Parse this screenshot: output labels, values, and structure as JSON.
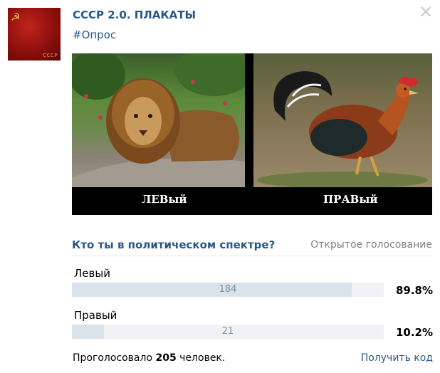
{
  "group": {
    "name": "СССР 2.0. ПЛАКАТЫ",
    "hashtag": "#Опрос",
    "avatar_icon": "hammer-sickle-icon",
    "avatar_tag": "СССР"
  },
  "poster": {
    "left_caption": "ЛЕВый",
    "right_caption": "ПРАВый",
    "left_subject": "lion",
    "right_subject": "rooster"
  },
  "poll": {
    "question": "Кто ты в политическом спектре?",
    "type_label": "Открытое голосование",
    "options": [
      {
        "label": "Левый",
        "votes": "184",
        "percent": "89.8%",
        "fraction": 0.898
      },
      {
        "label": "Правый",
        "votes": "21",
        "percent": "10.2%",
        "fraction": 0.102
      }
    ],
    "total_prefix": "Проголосовало ",
    "total": "205",
    "total_suffix": " человек.",
    "get_code": "Получить код"
  },
  "colors": {
    "link": "#2a5885",
    "bar_bg": "#f0f2f5",
    "bar_fill": "#dae2ea",
    "muted": "#828282"
  },
  "icons": {
    "close": "close-icon"
  }
}
